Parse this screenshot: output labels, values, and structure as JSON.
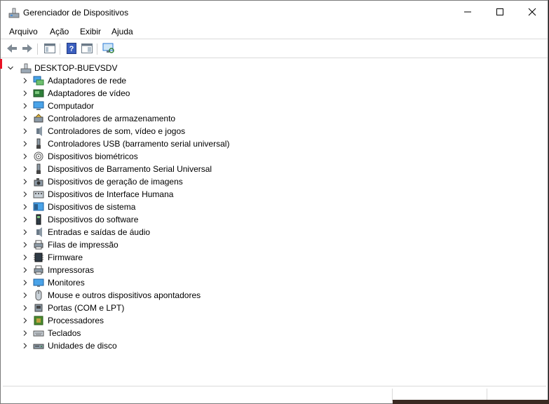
{
  "window": {
    "title": "Gerenciador de Dispositivos"
  },
  "menu": [
    "Arquivo",
    "Ação",
    "Exibir",
    "Ajuda"
  ],
  "toolbar": {
    "buttons": [
      "back-arrow-icon",
      "forward-arrow-icon",
      "console-tree-icon",
      "help-icon",
      "properties-icon",
      "scan-hardware-icon"
    ]
  },
  "tree": {
    "root": "DESKTOP-BUEVSDV",
    "categories": [
      "Adaptadores de rede",
      "Adaptadores de vídeo",
      "Computador",
      "Controladores de armazenamento",
      "Controladores de som, vídeo e jogos",
      "Controladores USB (barramento serial universal)",
      "Dispositivos biométricos",
      "Dispositivos de Barramento Serial Universal",
      "Dispositivos de geração de imagens",
      "Dispositivos de Interface Humana",
      "Dispositivos de sistema",
      "Dispositivos do software",
      "Entradas e saídas de áudio",
      "Filas de impressão",
      "Firmware",
      "Impressoras",
      "Monitores",
      "Mouse e outros dispositivos apontadores",
      "Portas (COM e LPT)",
      "Processadores",
      "Teclados",
      "Unidades de disco"
    ],
    "icons": [
      "network-adapter-icon",
      "display-adapter-icon",
      "computer-icon",
      "storage-controller-icon",
      "sound-controller-icon",
      "usb-controller-icon",
      "biometric-icon",
      "usb-device-icon",
      "imaging-device-icon",
      "hid-icon",
      "system-device-icon",
      "software-device-icon",
      "audio-io-icon",
      "print-queue-icon",
      "firmware-icon",
      "printer-icon",
      "monitor-icon",
      "mouse-icon",
      "port-icon",
      "processor-icon",
      "keyboard-icon",
      "disk-drive-icon"
    ]
  },
  "colors": {
    "accent_blue": "#2b79d6",
    "close_red": "#e81123"
  }
}
